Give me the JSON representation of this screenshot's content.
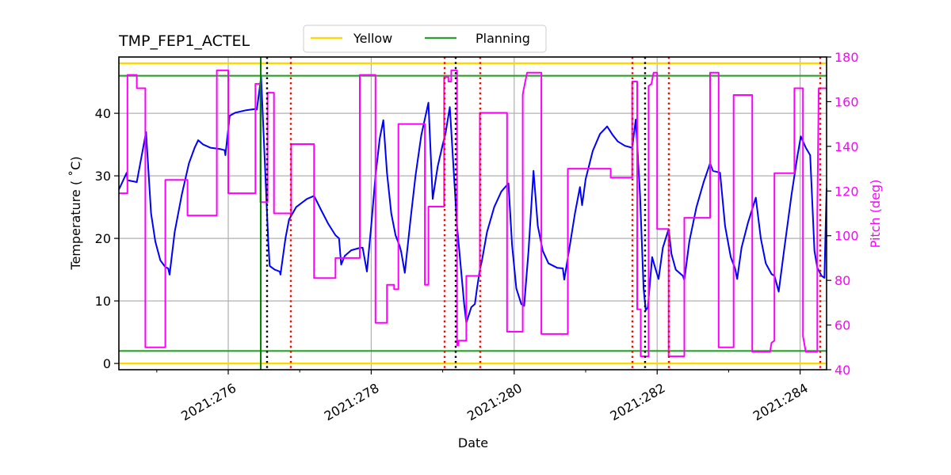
{
  "chart_data": {
    "type": "line",
    "title": "TMP_FEP1_ACTEL",
    "xlabel": "Date",
    "ylabel": "Temperature ($^\\circ$C)",
    "ylabel_display": "Temperature ( ˚C)",
    "y2label": "Pitch (deg)",
    "xlim": [
      274.47,
      284.37
    ],
    "ylim": [
      -1,
      49
    ],
    "y2lim": [
      40,
      180
    ],
    "grid": true,
    "legend_position": "top-center",
    "x_ticks": [
      {
        "value": 276,
        "label": "2021:276"
      },
      {
        "value": 278,
        "label": "2021:278"
      },
      {
        "value": 280,
        "label": "2021:280"
      },
      {
        "value": 282,
        "label": "2021:282"
      },
      {
        "value": 284,
        "label": "2021:284"
      }
    ],
    "x_minor_ticks": [
      275.0,
      277.0,
      279.0,
      281.0,
      283.0
    ],
    "y_ticks": [
      {
        "value": 0,
        "label": "0"
      },
      {
        "value": 10,
        "label": "10"
      },
      {
        "value": 20,
        "label": "20"
      },
      {
        "value": 30,
        "label": "30"
      },
      {
        "value": 40,
        "label": "40"
      }
    ],
    "y2_ticks": [
      {
        "value": 40,
        "label": "40"
      },
      {
        "value": 60,
        "label": "60"
      },
      {
        "value": 80,
        "label": "80"
      },
      {
        "value": 100,
        "label": "100"
      },
      {
        "value": 120,
        "label": "120"
      },
      {
        "value": 140,
        "label": "140"
      },
      {
        "value": 160,
        "label": "160"
      },
      {
        "value": 180,
        "label": "180"
      }
    ],
    "legend": [
      {
        "name": "Yellow",
        "color": "#ffd700"
      },
      {
        "name": "Planning",
        "color": "#2ca02c"
      }
    ],
    "limits": [
      {
        "name": "Yellow high",
        "group": "Yellow",
        "value": 48,
        "color": "#ffd700"
      },
      {
        "name": "Yellow low",
        "group": "Yellow",
        "value": 0,
        "color": "#ffd700"
      },
      {
        "name": "Planning high",
        "group": "Planning",
        "value": 46,
        "color": "#2ca02c"
      },
      {
        "name": "Planning low",
        "group": "Planning",
        "value": 2,
        "color": "#2ca02c"
      }
    ],
    "vertical_markers": [
      {
        "x": 276.455,
        "style": "solid",
        "color": "#008000"
      },
      {
        "x": 276.543,
        "style": "dotted",
        "color": "#000000"
      },
      {
        "x": 276.876,
        "style": "dotted",
        "color": "#ff0000"
      },
      {
        "x": 279.027,
        "style": "dotted",
        "color": "#ff0000"
      },
      {
        "x": 279.182,
        "style": "dotted",
        "color": "#000000"
      },
      {
        "x": 279.525,
        "style": "dotted",
        "color": "#ff0000"
      },
      {
        "x": 281.654,
        "style": "dotted",
        "color": "#ff0000"
      },
      {
        "x": 281.831,
        "style": "dotted",
        "color": "#000000"
      },
      {
        "x": 282.164,
        "style": "dotted",
        "color": "#ff0000"
      },
      {
        "x": 284.282,
        "style": "dotted",
        "color": "#ff0000"
      }
    ],
    "series": [
      {
        "name": "TMP_FEP1_ACTEL",
        "axis": "left",
        "color": "#0000ff",
        "points": [
          [
            274.47,
            27.8
          ],
          [
            274.58,
            30.5
          ],
          [
            274.59,
            29.3
          ],
          [
            274.72,
            29.0
          ],
          [
            274.85,
            37.0
          ],
          [
            274.92,
            24.0
          ],
          [
            274.98,
            19.5
          ],
          [
            275.05,
            16.5
          ],
          [
            275.12,
            15.4
          ],
          [
            275.16,
            15.2
          ],
          [
            275.18,
            14.2
          ],
          [
            275.25,
            21.0
          ],
          [
            275.35,
            27.0
          ],
          [
            275.45,
            32.0
          ],
          [
            275.53,
            34.5
          ],
          [
            275.58,
            35.7
          ],
          [
            275.65,
            35.0
          ],
          [
            275.75,
            34.5
          ],
          [
            275.88,
            34.3
          ],
          [
            275.95,
            34.1
          ],
          [
            275.96,
            33.3
          ],
          [
            276.0,
            37.5
          ],
          [
            276.02,
            39.6
          ],
          [
            276.1,
            40.1
          ],
          [
            276.25,
            40.5
          ],
          [
            276.38,
            40.7
          ],
          [
            276.4,
            40.6
          ],
          [
            276.46,
            45.8
          ],
          [
            276.52,
            30.0
          ],
          [
            276.56,
            19.5
          ],
          [
            276.58,
            15.6
          ],
          [
            276.65,
            15.0
          ],
          [
            276.72,
            14.7
          ],
          [
            276.73,
            14.2
          ],
          [
            276.8,
            20.0
          ],
          [
            276.85,
            23.0
          ],
          [
            276.95,
            25.0
          ],
          [
            277.1,
            26.3
          ],
          [
            277.2,
            26.8
          ],
          [
            277.3,
            24.5
          ],
          [
            277.4,
            22.3
          ],
          [
            277.5,
            20.5
          ],
          [
            277.55,
            20.0
          ],
          [
            277.58,
            15.8
          ],
          [
            277.63,
            17.2
          ],
          [
            277.72,
            18.1
          ],
          [
            277.85,
            18.5
          ],
          [
            277.88,
            18.5
          ],
          [
            277.94,
            14.7
          ],
          [
            278.0,
            22.0
          ],
          [
            278.06,
            30.0
          ],
          [
            278.12,
            36.0
          ],
          [
            278.17,
            38.9
          ],
          [
            278.22,
            30.5
          ],
          [
            278.28,
            24.0
          ],
          [
            278.34,
            20.5
          ],
          [
            278.4,
            18.7
          ],
          [
            278.42,
            17.8
          ],
          [
            278.47,
            14.5
          ],
          [
            278.55,
            23.0
          ],
          [
            278.62,
            30.0
          ],
          [
            278.7,
            36.5
          ],
          [
            278.8,
            41.7
          ],
          [
            278.86,
            26.3
          ],
          [
            278.93,
            31.5
          ],
          [
            279.0,
            35.0
          ],
          [
            279.04,
            36.8
          ],
          [
            279.1,
            41.0
          ],
          [
            279.2,
            22.0
          ],
          [
            279.3,
            9.5
          ],
          [
            279.33,
            6.5
          ],
          [
            279.4,
            9.0
          ],
          [
            279.45,
            9.5
          ],
          [
            279.48,
            12.0
          ],
          [
            279.52,
            15.0
          ],
          [
            279.55,
            16.5
          ],
          [
            279.62,
            21.0
          ],
          [
            279.72,
            25.0
          ],
          [
            279.82,
            27.5
          ],
          [
            279.92,
            28.8
          ],
          [
            279.97,
            19.0
          ],
          [
            280.03,
            12.0
          ],
          [
            280.1,
            9.5
          ],
          [
            280.14,
            9.2
          ],
          [
            280.2,
            18.0
          ],
          [
            280.27,
            30.8
          ],
          [
            280.33,
            22.0
          ],
          [
            280.4,
            18.0
          ],
          [
            280.48,
            16.0
          ],
          [
            280.6,
            15.3
          ],
          [
            280.68,
            15.2
          ],
          [
            280.7,
            13.4
          ],
          [
            280.78,
            19.0
          ],
          [
            280.85,
            24.0
          ],
          [
            280.92,
            28.2
          ],
          [
            280.95,
            25.3
          ],
          [
            281.0,
            29.5
          ],
          [
            281.1,
            34.0
          ],
          [
            281.2,
            36.7
          ],
          [
            281.3,
            37.9
          ],
          [
            281.38,
            36.5
          ],
          [
            281.45,
            35.5
          ],
          [
            281.55,
            34.8
          ],
          [
            281.65,
            34.5
          ],
          [
            281.7,
            39.0
          ],
          [
            281.76,
            27.0
          ],
          [
            281.81,
            12.0
          ],
          [
            281.84,
            8.5
          ],
          [
            281.87,
            9.0
          ],
          [
            281.93,
            17.0
          ],
          [
            281.98,
            15.0
          ],
          [
            282.02,
            13.5
          ],
          [
            282.08,
            18.5
          ],
          [
            282.16,
            21.5
          ],
          [
            282.2,
            17.5
          ],
          [
            282.26,
            15.0
          ],
          [
            282.36,
            14.0
          ],
          [
            282.38,
            13.3
          ],
          [
            282.45,
            19.5
          ],
          [
            282.55,
            25.0
          ],
          [
            282.65,
            29.0
          ],
          [
            282.74,
            32.0
          ],
          [
            282.78,
            30.8
          ],
          [
            282.88,
            30.5
          ],
          [
            282.95,
            22.0
          ],
          [
            283.03,
            17.0
          ],
          [
            283.09,
            15.2
          ],
          [
            283.12,
            13.5
          ],
          [
            283.18,
            18.5
          ],
          [
            283.27,
            22.5
          ],
          [
            283.38,
            26.5
          ],
          [
            283.45,
            20.0
          ],
          [
            283.52,
            16.0
          ],
          [
            283.6,
            14.3
          ],
          [
            283.64,
            14.0
          ],
          [
            283.7,
            11.5
          ],
          [
            283.78,
            18.5
          ],
          [
            283.88,
            27.0
          ],
          [
            283.96,
            33.0
          ],
          [
            284.01,
            36.3
          ],
          [
            284.08,
            34.5
          ],
          [
            284.14,
            33.3
          ],
          [
            284.2,
            18.0
          ],
          [
            284.24,
            15.3
          ],
          [
            284.3,
            14.0
          ],
          [
            284.34,
            13.7
          ],
          [
            284.37,
            28.0
          ]
        ]
      },
      {
        "name": "Pitch",
        "axis": "right",
        "color": "#ff00ff",
        "points": [
          [
            274.47,
            119
          ],
          [
            274.59,
            119
          ],
          [
            274.59,
            172
          ],
          [
            274.72,
            172
          ],
          [
            274.72,
            166
          ],
          [
            274.84,
            166
          ],
          [
            274.84,
            50
          ],
          [
            275.12,
            50
          ],
          [
            275.12,
            125
          ],
          [
            275.43,
            125
          ],
          [
            275.43,
            109
          ],
          [
            275.84,
            109
          ],
          [
            275.84,
            174
          ],
          [
            276.0,
            174
          ],
          [
            276.0,
            119
          ],
          [
            276.38,
            119
          ],
          [
            276.38,
            168
          ],
          [
            276.45,
            168
          ],
          [
            276.45,
            115
          ],
          [
            276.55,
            115
          ],
          [
            276.55,
            164
          ],
          [
            276.64,
            164
          ],
          [
            276.64,
            110
          ],
          [
            276.88,
            110
          ],
          [
            276.88,
            141
          ],
          [
            277.2,
            141
          ],
          [
            277.2,
            81
          ],
          [
            277.5,
            81
          ],
          [
            277.5,
            90
          ],
          [
            277.84,
            90
          ],
          [
            277.84,
            172
          ],
          [
            278.06,
            172
          ],
          [
            278.06,
            61
          ],
          [
            278.22,
            61
          ],
          [
            278.22,
            78
          ],
          [
            278.32,
            78
          ],
          [
            278.32,
            76
          ],
          [
            278.38,
            76
          ],
          [
            278.38,
            150
          ],
          [
            278.75,
            150
          ],
          [
            278.75,
            78
          ],
          [
            278.8,
            78
          ],
          [
            278.8,
            113
          ],
          [
            279.02,
            113
          ],
          [
            279.02,
            171
          ],
          [
            279.08,
            171
          ],
          [
            279.08,
            169
          ],
          [
            279.12,
            169
          ],
          [
            279.12,
            174
          ],
          [
            279.2,
            174
          ],
          [
            279.2,
            51
          ],
          [
            279.22,
            51
          ],
          [
            279.22,
            53
          ],
          [
            279.33,
            53
          ],
          [
            279.33,
            82
          ],
          [
            279.52,
            82
          ],
          [
            279.52,
            155
          ],
          [
            279.9,
            155
          ],
          [
            279.9,
            57
          ],
          [
            280.12,
            57
          ],
          [
            280.12,
            163
          ],
          [
            280.13,
            165
          ],
          [
            280.18,
            173
          ],
          [
            280.38,
            173
          ],
          [
            280.38,
            56
          ],
          [
            280.75,
            56
          ],
          [
            280.75,
            130
          ],
          [
            281.35,
            130
          ],
          [
            281.35,
            126
          ],
          [
            281.65,
            126
          ],
          [
            281.65,
            169
          ],
          [
            281.72,
            169
          ],
          [
            281.72,
            67
          ],
          [
            281.77,
            67
          ],
          [
            281.77,
            46
          ],
          [
            281.88,
            46
          ],
          [
            281.88,
            167
          ],
          [
            281.92,
            168
          ],
          [
            281.95,
            173
          ],
          [
            282.0,
            173
          ],
          [
            282.0,
            103
          ],
          [
            282.16,
            103
          ],
          [
            282.16,
            46
          ],
          [
            282.38,
            46
          ],
          [
            282.38,
            108
          ],
          [
            282.74,
            108
          ],
          [
            282.74,
            173
          ],
          [
            282.86,
            173
          ],
          [
            282.86,
            50
          ],
          [
            283.07,
            50
          ],
          [
            283.07,
            163
          ],
          [
            283.33,
            163
          ],
          [
            283.33,
            48
          ],
          [
            283.58,
            48
          ],
          [
            283.6,
            52
          ],
          [
            283.64,
            53
          ],
          [
            283.64,
            128
          ],
          [
            283.92,
            128
          ],
          [
            283.92,
            166
          ],
          [
            284.04,
            166
          ],
          [
            284.04,
            55
          ],
          [
            284.08,
            48
          ],
          [
            284.24,
            48
          ],
          [
            284.24,
            110
          ],
          [
            284.26,
            166
          ],
          [
            284.37,
            166
          ]
        ]
      }
    ]
  }
}
